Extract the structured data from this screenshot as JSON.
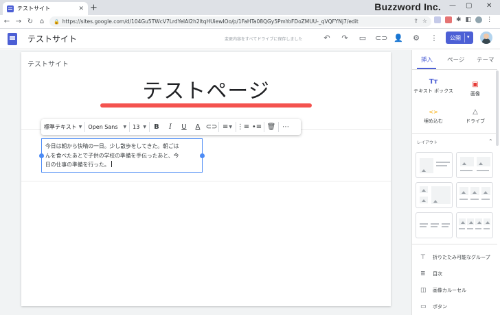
{
  "browser": {
    "tab_title": "テストサイト",
    "tab_close": "✕",
    "new_tab": "+",
    "watermark": "Buzzword Inc.",
    "window_controls": [
      "—",
      "▢",
      "✕"
    ],
    "url": "https://sites.google.com/d/104Gu5TWcV7LrdYeIAI2h2ltqHUiewIOo/p/1FaHTa08QGy5PmYoFDoZMUU-_qVQFYNj7/edit"
  },
  "sites_header": {
    "doc_title": "テストサイト",
    "save_status": "変更内容をすべてドライブに保存しました",
    "publish_label": "公開"
  },
  "page": {
    "site_name": "テストサイト",
    "title": "テストページ",
    "accent_color": "#f4534f",
    "body_lines": [
      "今日は朝から快晴の一日。少し散歩をしてきた。朝ごは",
      "んを食べたあとで子供の学校の準備を手伝ったあと、今",
      "日の仕事の準備を行った。"
    ]
  },
  "format_toolbar": {
    "style": "標準テキスト",
    "font": "Open Sans",
    "size": "13",
    "bold": "B",
    "italic": "I",
    "underline": "U",
    "color": "A"
  },
  "panel": {
    "tabs": [
      "挿入",
      "ページ",
      "テーマ"
    ],
    "insert": [
      {
        "icon": "Tт",
        "label": "テキスト ボックス"
      },
      {
        "icon": "▣",
        "label": "画像"
      },
      {
        "icon": "<>",
        "label": "埋め込む"
      },
      {
        "icon": "△",
        "label": "ドライブ"
      }
    ],
    "layout_header": "レイアウト",
    "items": [
      {
        "icon": "⊤",
        "label": "折りたたみ可能なグループ"
      },
      {
        "icon": "≣",
        "label": "目次"
      },
      {
        "icon": "◫",
        "label": "画像カルーセル"
      },
      {
        "icon": "▭",
        "label": "ボタン"
      }
    ]
  },
  "colors": {
    "brand": "#4c5fd5",
    "selection": "#4c8bf5"
  }
}
